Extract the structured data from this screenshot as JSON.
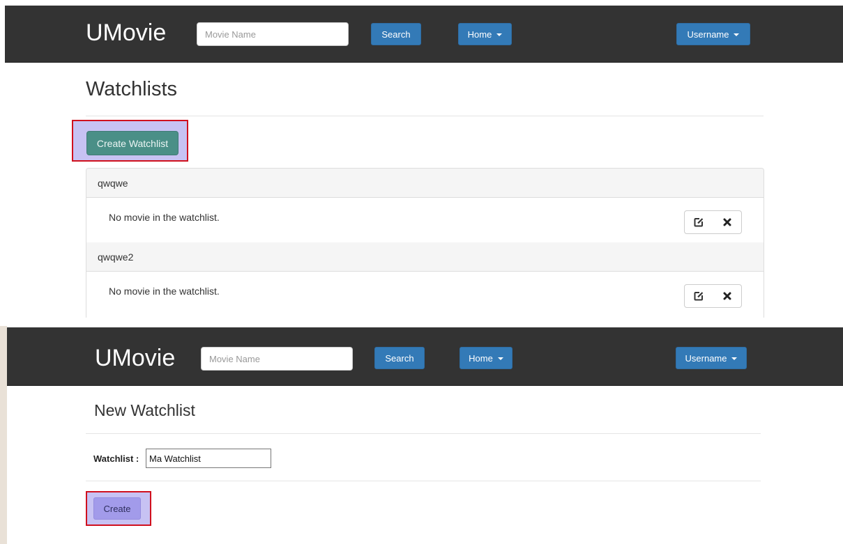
{
  "top": {
    "nav": {
      "brand": "UMovie",
      "search_placeholder": "Movie Name",
      "search_button": "Search",
      "home_menu": "Home",
      "user_menu": "Username"
    },
    "page_title": "Watchlists",
    "create_button": "Create Watchlist",
    "watchlists": [
      {
        "name": "qwqwe",
        "empty_message": "No movie in the watchlist."
      },
      {
        "name": "qwqwe2",
        "empty_message": "No movie in the watchlist."
      }
    ]
  },
  "bottom": {
    "nav": {
      "brand": "UMovie",
      "search_placeholder": "Movie Name",
      "search_button": "Search",
      "home_menu": "Home",
      "user_menu": "Username"
    },
    "page_title": "New Watchlist",
    "field_label": "Watchlist :",
    "field_value": "Ma Watchlist",
    "create_button": "Create"
  },
  "icons": {
    "edit": "edit-icon",
    "remove": "remove-icon",
    "caret": "caret-down-icon"
  },
  "colors": {
    "navbar": "#333333",
    "primary": "#337ab7",
    "create_watchlist_button": "#4a8f87",
    "highlight_fill": "#c7c2f3",
    "highlight_border": "#d0101e"
  }
}
